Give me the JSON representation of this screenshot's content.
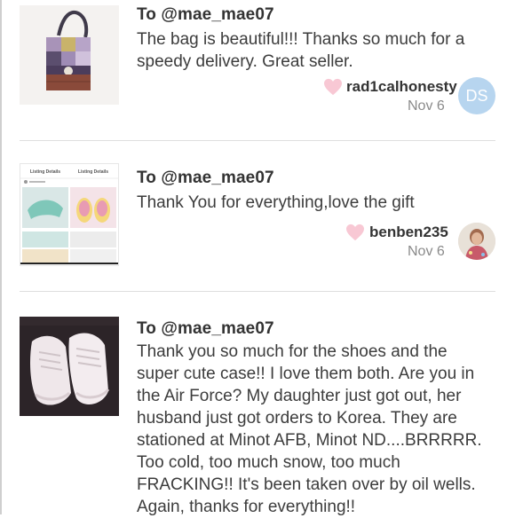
{
  "comments": [
    {
      "recipient": "To @mae_mae07",
      "message": "The bag is beautiful!!! Thanks so much for a speedy delivery. Great seller.",
      "sender": "rad1calhonesty",
      "date": "Nov 6",
      "avatar_initials": "DS",
      "thumbnail": "purple-patchwork-bag-photo"
    },
    {
      "recipient": "To @mae_mae07",
      "message": "Thank You for everything,love the gift",
      "sender": "benben235",
      "date": "Nov 6",
      "thumbnail": "listing-details-screenshot",
      "thumbnail_headers": [
        "Listing Details",
        "Listing Details"
      ]
    },
    {
      "recipient": "To @mae_mae07",
      "message": "Thank you so much for the shoes and the super cute case!! I love them both. Are you in the Air Force? My daughter just got out, her husband just got orders to Korea. They are stationed at Minot AFB, Minot ND....BRRRRR. Too cold, too much snow, too much FRACKING!! It's been taken over by oil wells. Again, thanks for everything!!",
      "thumbnail": "white-sneakers-photo"
    }
  ],
  "colors": {
    "heart": "#f8c8d4",
    "avatar_ds": "#b7d5ef",
    "divider": "#dedede"
  }
}
